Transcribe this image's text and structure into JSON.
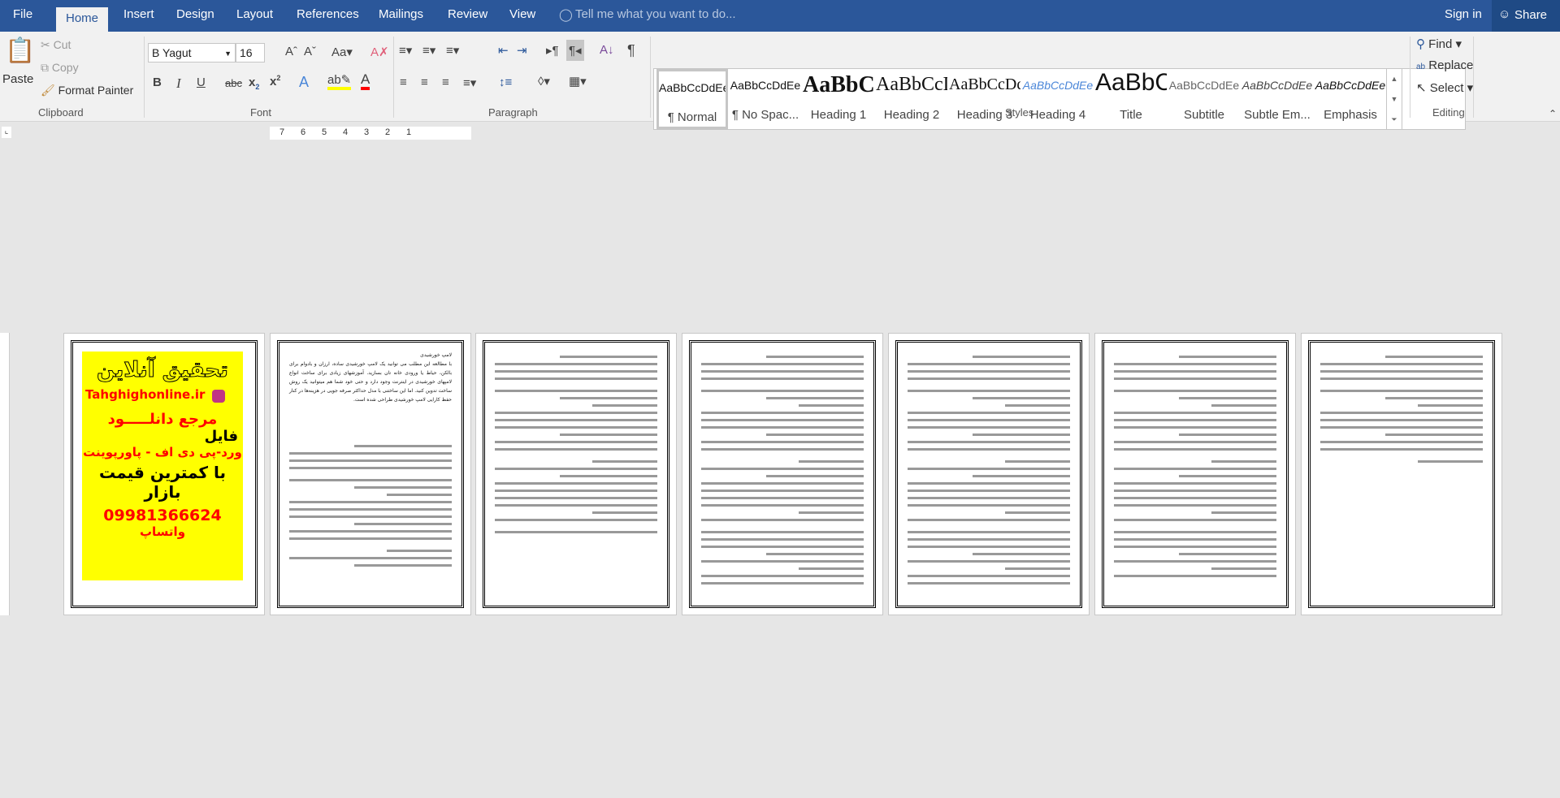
{
  "tabs": [
    "File",
    "Home",
    "Insert",
    "Design",
    "Layout",
    "References",
    "Mailings",
    "Review",
    "View"
  ],
  "active_tab": "Home",
  "tell_me": "Tell me what you want to do...",
  "sign_in": "Sign in",
  "share": "Share",
  "clipboard": {
    "paste": "Paste",
    "cut": "Cut",
    "copy": "Copy",
    "format_painter": "Format Painter",
    "label": "Clipboard"
  },
  "font": {
    "name": "B Yagut",
    "size": "16",
    "label": "Font",
    "highlight_color": "#ffff00",
    "font_color": "#ff0000"
  },
  "paragraph": {
    "label": "Paragraph"
  },
  "styles": {
    "label": "Styles",
    "items": [
      {
        "preview": "AaBbCcDdEe",
        "name": "¶ Normal"
      },
      {
        "preview": "AaBbCcDdEe",
        "name": "¶ No Spac..."
      },
      {
        "preview": "AaBbCcDdEe",
        "name": "Heading 1"
      },
      {
        "preview": "AaBbCcDdEe",
        "name": "Heading 2"
      },
      {
        "preview": "AaBbCcDdEe",
        "name": "Heading 3"
      },
      {
        "preview": "AaBbCcDdEe",
        "name": "Heading 4"
      },
      {
        "preview": "AaBbCcDdEe",
        "name": "Title"
      },
      {
        "preview": "AaBbCcDdEe",
        "name": "Subtitle"
      },
      {
        "preview": "AaBbCcDdEe",
        "name": "Subtle Em..."
      },
      {
        "preview": "AaBbCcDdEe",
        "name": "Emphasis"
      }
    ]
  },
  "editing": {
    "find": "Find",
    "replace": "Replace",
    "select": "Select",
    "label": "Editing"
  },
  "ruler_numbers": [
    "7",
    "6",
    "5",
    "4",
    "3",
    "2",
    "1"
  ],
  "cover": {
    "title": "تحقیق آنلاین",
    "site": "Tahghighonline.ir",
    "line1": "مرجع دانلـــــود",
    "line2": "فایل",
    "line3": "ورد-پی دی اف - پاورپوینت",
    "line4": "با کمترین قیمت بازار",
    "phone": "09981366624",
    "whatsapp": "واتساپ"
  },
  "page2_heading": "لامپ خورشیدی",
  "page2_para": "با مطالعه این مطلب می توانید یک لامپ خورشیدی ساده، ارزان و بادوام برای بالکن، حیاط یا ورودی خانه تان بسازید. آموزشهای زیادی برای ساخت انواع لامپهای خورشیدی در اینترنت وجود دارد و حتی خود شما هم میتوانید یک روش ساخت تدوین کنید. اما این ساختنی با مدل حداکثر صرفه جویی در هزینه‌ها در کنار حفظ کارایی لامپ خورشیدی طراحی شده است."
}
